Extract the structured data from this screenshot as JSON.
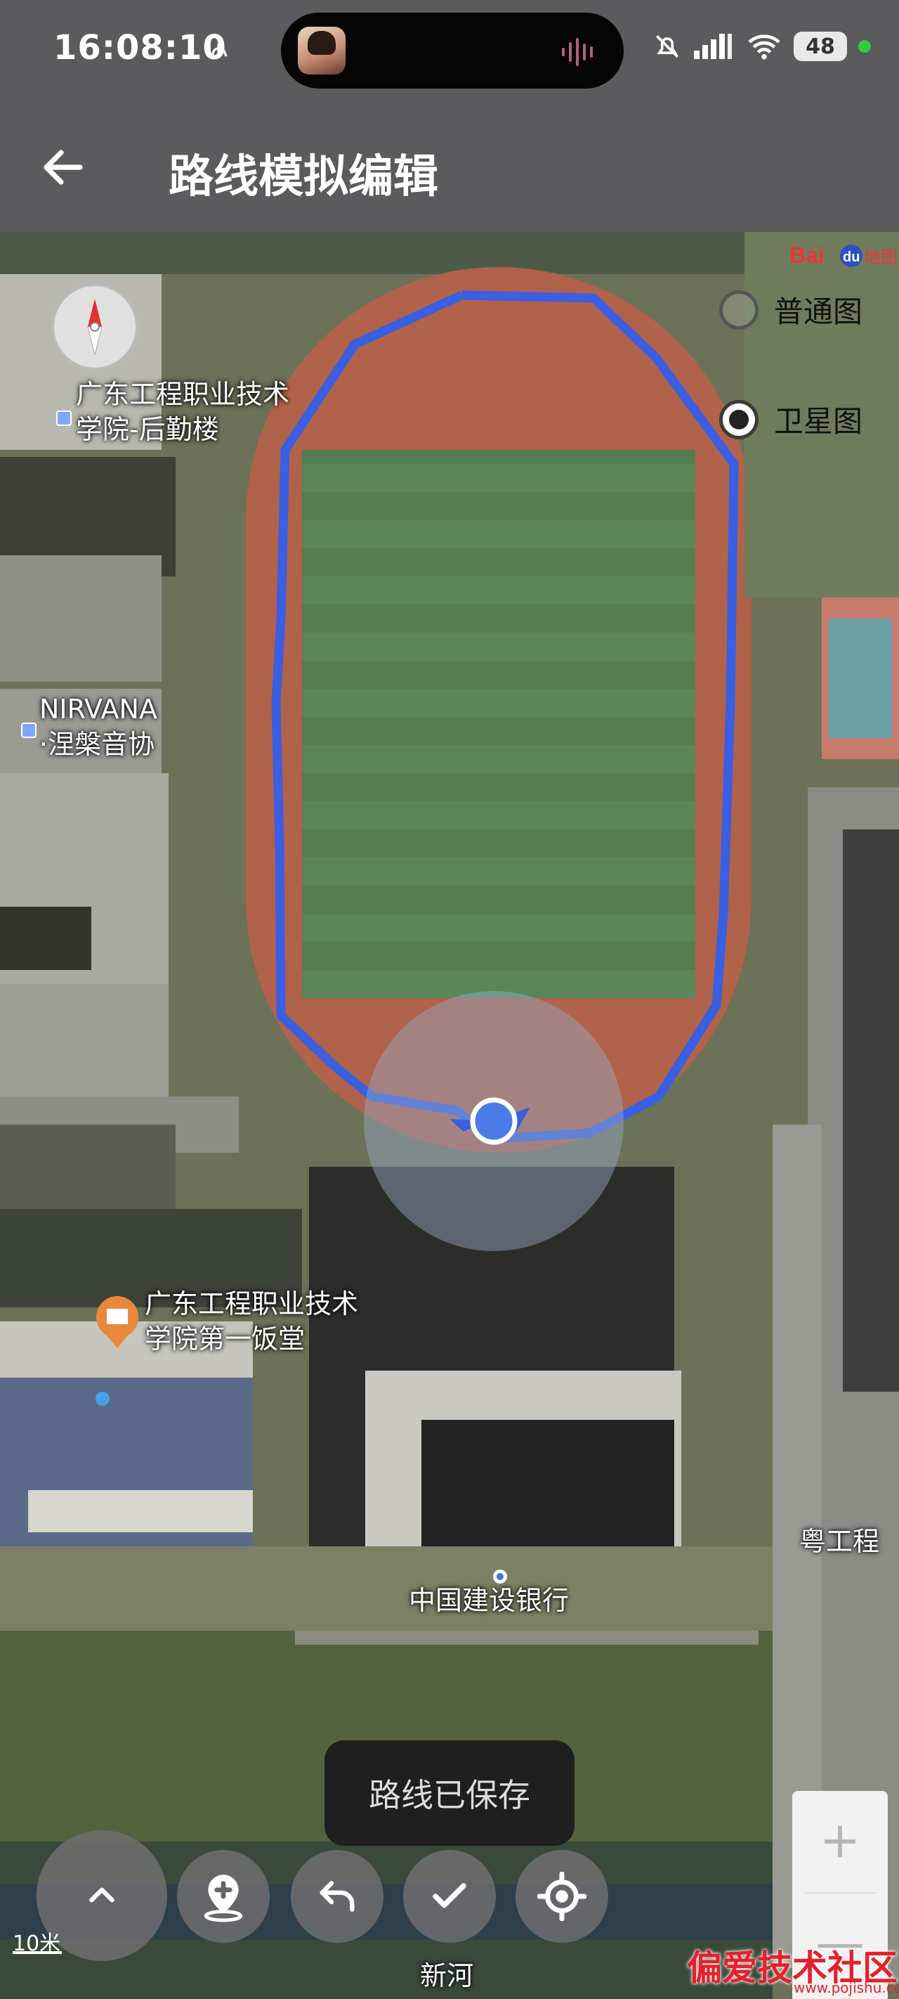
{
  "status_bar": {
    "time": "16:08:10",
    "battery": "48",
    "icons": [
      "accessibility-icon",
      "mute-icon",
      "signal-icon",
      "wifi-icon",
      "battery-icon"
    ]
  },
  "app_bar": {
    "title": "路线模拟编辑",
    "back_icon": "arrow-left-icon"
  },
  "map": {
    "provider_logo": "Baidu地图",
    "map_types": [
      {
        "label": "普通图",
        "selected": false
      },
      {
        "label": "卫星图",
        "selected": true
      }
    ],
    "poi_labels": {
      "logistics_building": "广东工程职业技术\n学院-后勤楼",
      "nirvana": "NIRVANA\n·涅槃音协",
      "canteen": "广东工程职业技术\n学院第一饭堂",
      "bank": "中国建设银行",
      "right_edge": "粤工程",
      "river": "新河"
    },
    "route_color": "#3a5fe0",
    "scale_text": "10米"
  },
  "toast": {
    "text": "路线已保存"
  },
  "toolbar": {
    "collapse_icon": "chevron-up-icon",
    "add_point_icon": "add-location-icon",
    "undo_icon": "undo-icon",
    "confirm_icon": "check-icon",
    "locate_icon": "locate-icon"
  },
  "zoom": {
    "in_label": "+",
    "out_label": "—"
  },
  "watermark": {
    "text": "偏爱技术社区",
    "url": "www.pojishu.com"
  }
}
